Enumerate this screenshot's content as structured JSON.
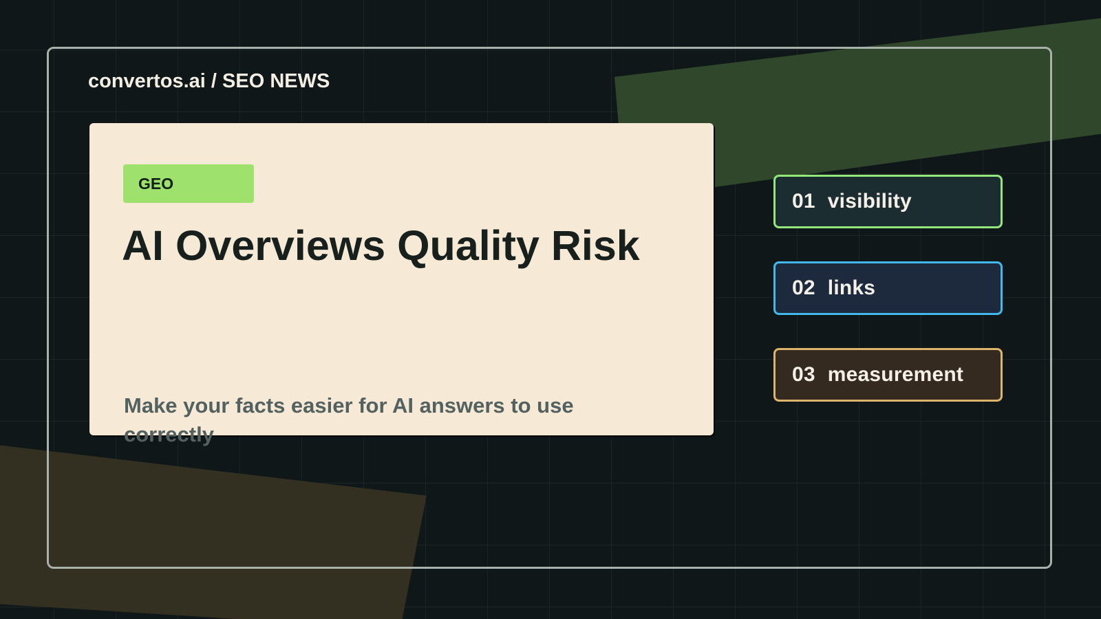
{
  "site": {
    "breadcrumb": "convertos.ai / SEO NEWS"
  },
  "article": {
    "tag": "GEO",
    "title": "AI Overviews Quality Risk",
    "subtitle": "Make your facts easier for AI answers to use correctly"
  },
  "highlights": [
    {
      "number": "01",
      "label": "visibility",
      "border_color": "#94e77b"
    },
    {
      "number": "02",
      "label": "links",
      "border_color": "#42b9ea"
    },
    {
      "number": "03",
      "label": "measurement",
      "border_color": "#ddb46c"
    }
  ],
  "colors": {
    "background": "#0f1718",
    "frame": "#a8b1aa",
    "card": "#f6ead6",
    "tag": "#9fe16d",
    "green_band": "#30472c",
    "olive_band": "#332f21"
  }
}
